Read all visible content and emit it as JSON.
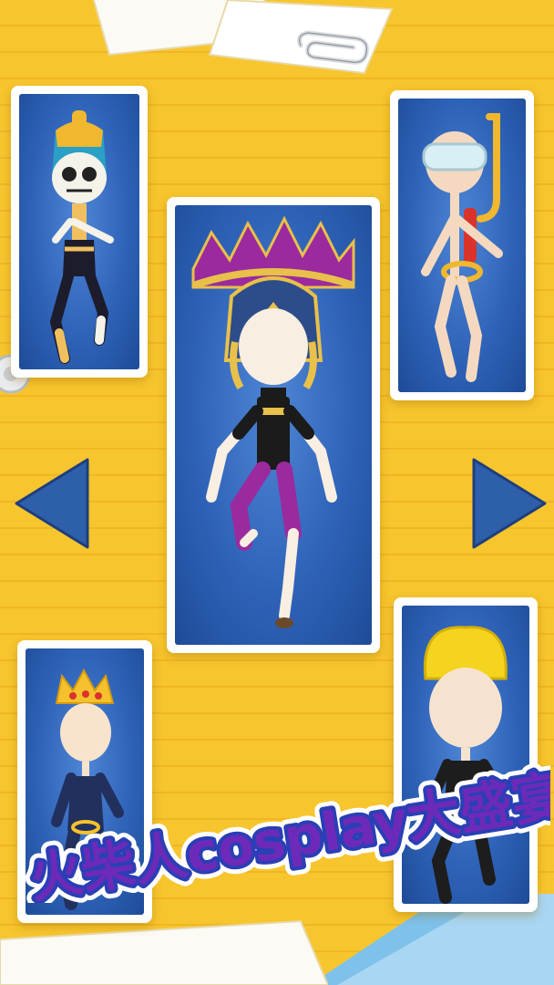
{
  "banner": {
    "title": "火柴人cosplay大盛宴"
  },
  "characters": [
    {
      "name": "skeleton-pharaoh",
      "position": "top-left"
    },
    {
      "name": "diver-snorkel",
      "position": "top-right"
    },
    {
      "name": "roman-gladiator",
      "position": "center",
      "selected": true
    },
    {
      "name": "king-crown",
      "position": "bottom-left"
    },
    {
      "name": "yellow-beanie",
      "position": "bottom-right"
    }
  ],
  "navigation": {
    "prev_icon": "triangle-left-icon",
    "next_icon": "triangle-right-icon"
  },
  "colors": {
    "background": "#F7C52D",
    "card_blue": "#2f63b8",
    "arrow_blue": "#2e5fab",
    "banner_purple": "#6d2ab8",
    "banner_blue_outline": "#2a3fb5"
  }
}
